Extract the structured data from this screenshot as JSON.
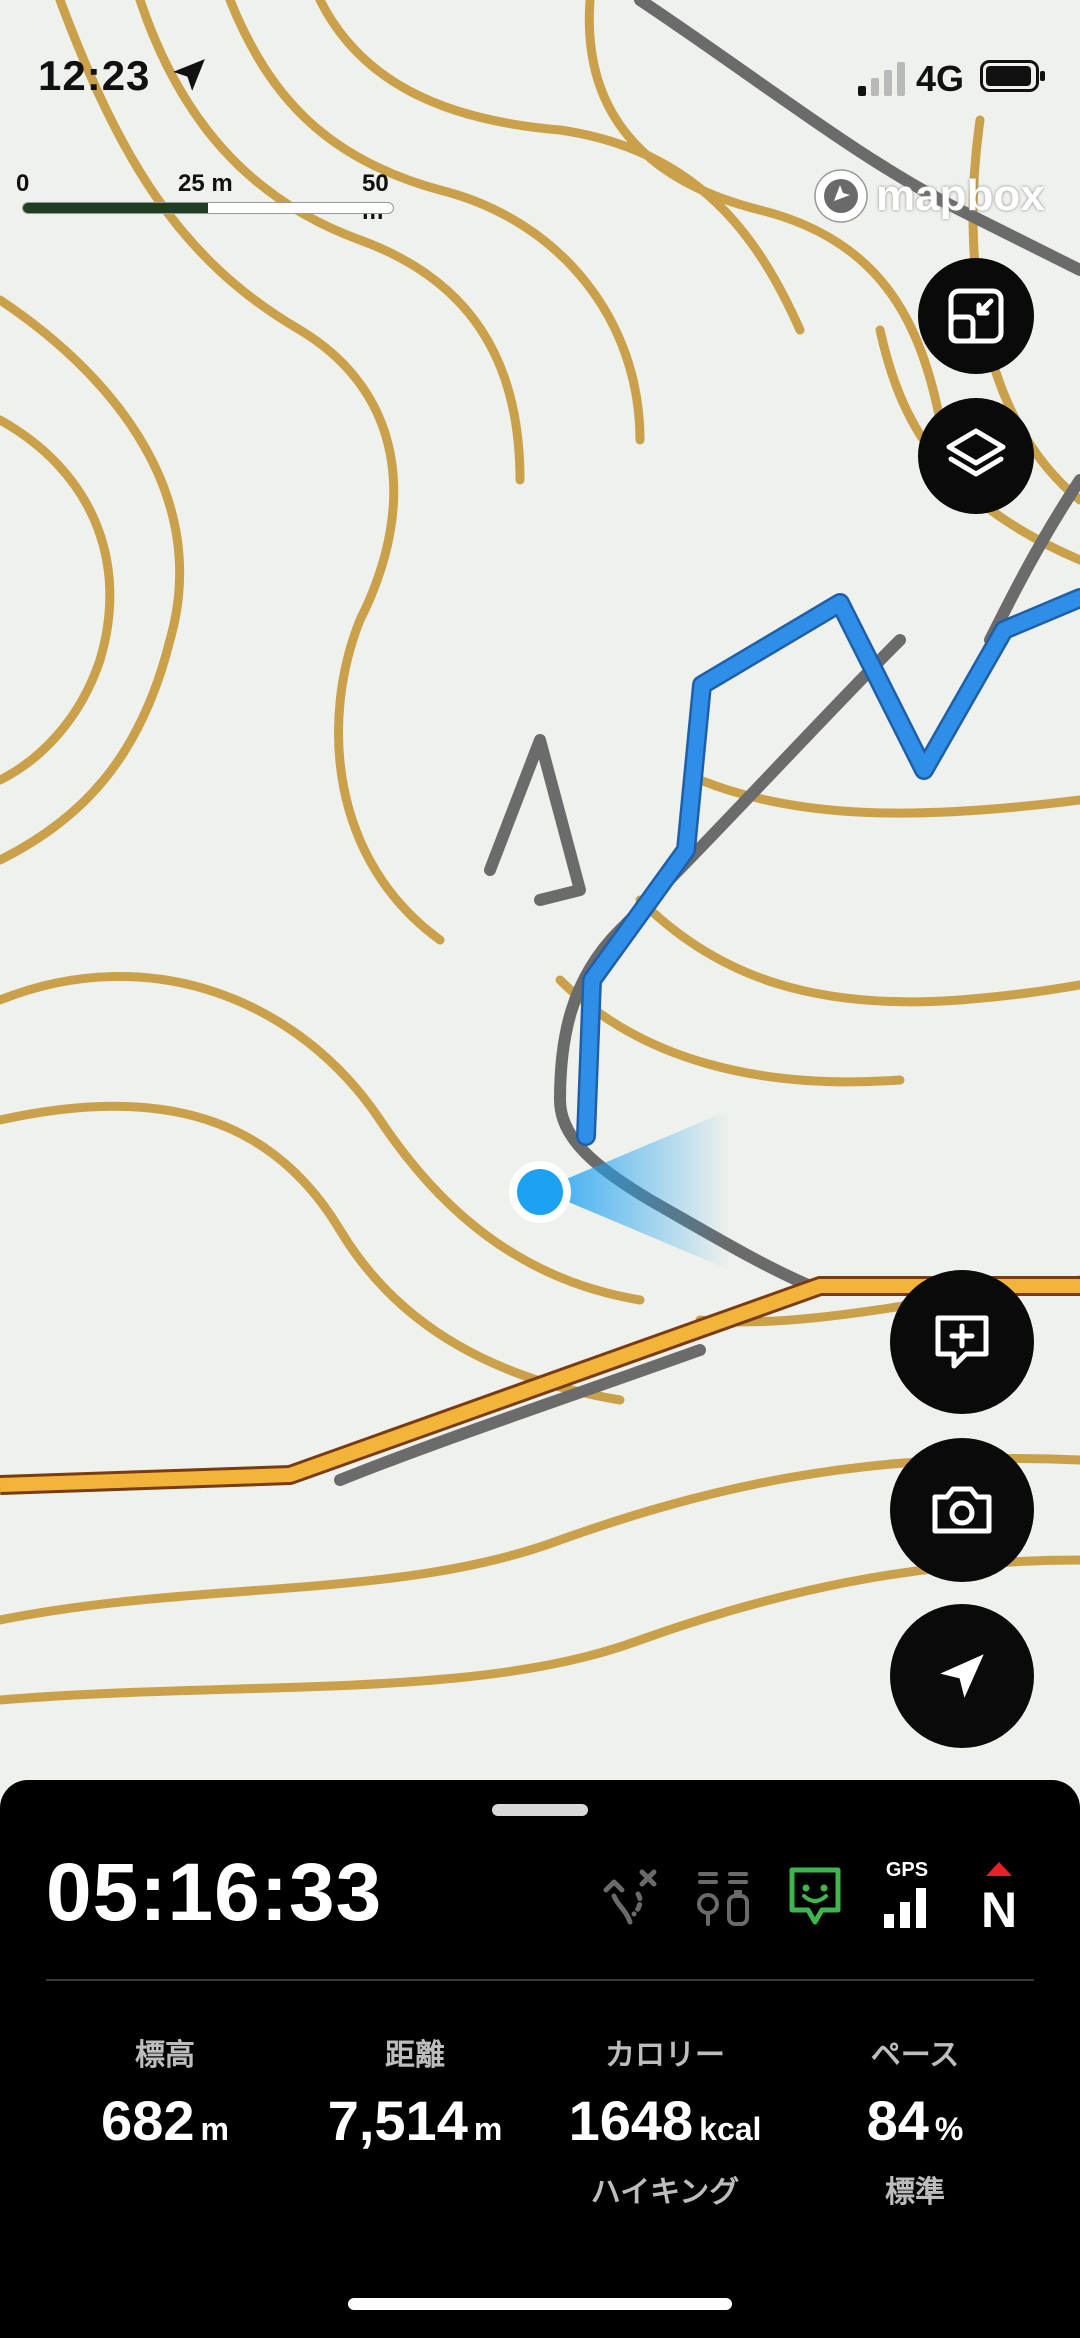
{
  "status_bar": {
    "time": "12:23",
    "network": "4G"
  },
  "map": {
    "scale": {
      "labels": [
        "0",
        "25 m",
        "50 m"
      ]
    },
    "attribution": "mapbox",
    "colors": {
      "route": "#2f8fe8",
      "road": "#f2b53a",
      "contour": "#caa14a",
      "trail": "#6b6b6b",
      "location": "#1da1f2"
    }
  },
  "map_controls": {
    "fit_button": {
      "icon": "fit-view-icon"
    },
    "layers_button": {
      "icon": "layers-icon"
    },
    "add_note_button": {
      "icon": "add-note-icon"
    },
    "camera_button": {
      "icon": "camera-icon"
    },
    "locate_button": {
      "icon": "navigation-arrow-icon"
    }
  },
  "activity_panel": {
    "elapsed_time": "05:16:33",
    "status_icons": [
      {
        "name": "off-route-icon",
        "color": "#6a6a6a"
      },
      {
        "name": "rest-points-icon",
        "color": "#6a6a6a"
      },
      {
        "name": "companion-status-icon",
        "color": "#3fb54f"
      },
      {
        "name": "gps-signal-icon",
        "label": "GPS",
        "color": "#ffffff"
      },
      {
        "name": "north-compass-icon",
        "label": "N",
        "color": "#ffffff",
        "accent": "#e8202a"
      }
    ],
    "stats": [
      {
        "label": "標高",
        "value": "682",
        "unit": "m"
      },
      {
        "label": "距離",
        "value": "7,514",
        "unit": "m"
      },
      {
        "label": "カロリー",
        "value": "1648",
        "unit": "kcal",
        "sub": "ハイキング"
      },
      {
        "label": "ペース",
        "value": "84",
        "unit": "%",
        "sub": "標準"
      }
    ]
  }
}
